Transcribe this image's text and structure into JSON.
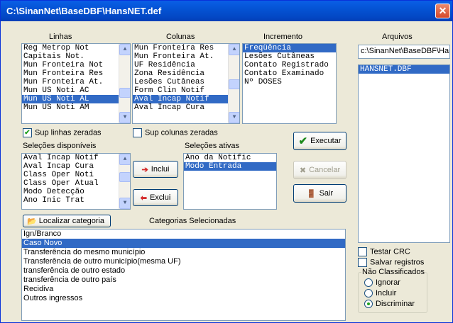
{
  "window": {
    "title": "C:\\SinanNet\\BaseDBF\\HansNET.def",
    "close_glyph": "✕"
  },
  "headers": {
    "linhas": "Linhas",
    "colunas": "Colunas",
    "incremento": "Incremento",
    "arquivos": "Arquivos",
    "selecoes_disponiveis": "Seleções disponíveis",
    "selecoes_ativas": "Seleções ativas",
    "categorias_selecionadas": "Categorias Selecionadas"
  },
  "linhas_list": [
    "Reg Metrop Not",
    "Capitais Not.",
    "Mun Fronteira Not",
    "Mun Fronteira Res",
    "Mun Fronteira At.",
    "Mun US Noti AC",
    "Mun US Noti AL",
    "Mun US Noti AM"
  ],
  "linhas_selected": "Mun US Noti AL",
  "colunas_list": [
    "Mun Fronteira Res",
    "Mun Fronteira At.",
    "UF Residência",
    "Zona Residência",
    "Lesões Cutâneas",
    "Form Clin Notif",
    "Aval Incap Notif",
    "Aval Incap Cura"
  ],
  "colunas_selected": "Aval Incap Notif",
  "incremento_list": [
    "Freqüência",
    "Lesões Cutâneas",
    "Contato Registrado",
    "Contato Examinado",
    "Nº DOSES"
  ],
  "incremento_selected": "Freqüência",
  "arquivos": {
    "path": "c:\\SinanNet\\BaseDBF\\Har",
    "files": [
      "HANSNET.DBF"
    ],
    "selected": "HANSNET.DBF"
  },
  "checks": {
    "sup_linhas": "Sup linhas zeradas",
    "sup_linhas_checked": true,
    "sup_colunas": "Sup colunas zeradas",
    "sup_colunas_checked": false
  },
  "selecoes_disponiveis_list": [
    "Aval Incap Notif",
    "Aval Incap Cura",
    "Class Oper Noti",
    "Class Oper Atual",
    "Modo Detecção",
    "Ano Inic Trat"
  ],
  "selecoes_ativas_list": [
    "Ano da Notific",
    "Modo Entrada"
  ],
  "selecoes_ativas_selected": "Modo Entrada",
  "buttons": {
    "inclui": "Inclui",
    "exclui": "Exclui",
    "executar": "Executar",
    "cancelar": "Cancelar",
    "sair": "Sair",
    "localizar_categoria": "Localizar categoria"
  },
  "categorias_list": [
    "Ign/Branco",
    "Caso Novo",
    "Transferência do mesmo município",
    "Transferência de outro município(mesma UF)",
    "transferência de outro estado",
    "transferência de outro país",
    "Recidiva",
    "Outros ingressos"
  ],
  "categorias_selected": "Caso Novo",
  "options": {
    "testar_crc": "Testar CRC",
    "salvar_registros": "Salvar registros"
  },
  "nao_classificados": {
    "title": "Não Classificados",
    "options": [
      "Ignorar",
      "Incluir",
      "Discriminar"
    ],
    "selected": "Discriminar"
  },
  "colors": {
    "accent": "#316ac5",
    "titlebar": "#0453d4",
    "face": "#ece9d8"
  }
}
